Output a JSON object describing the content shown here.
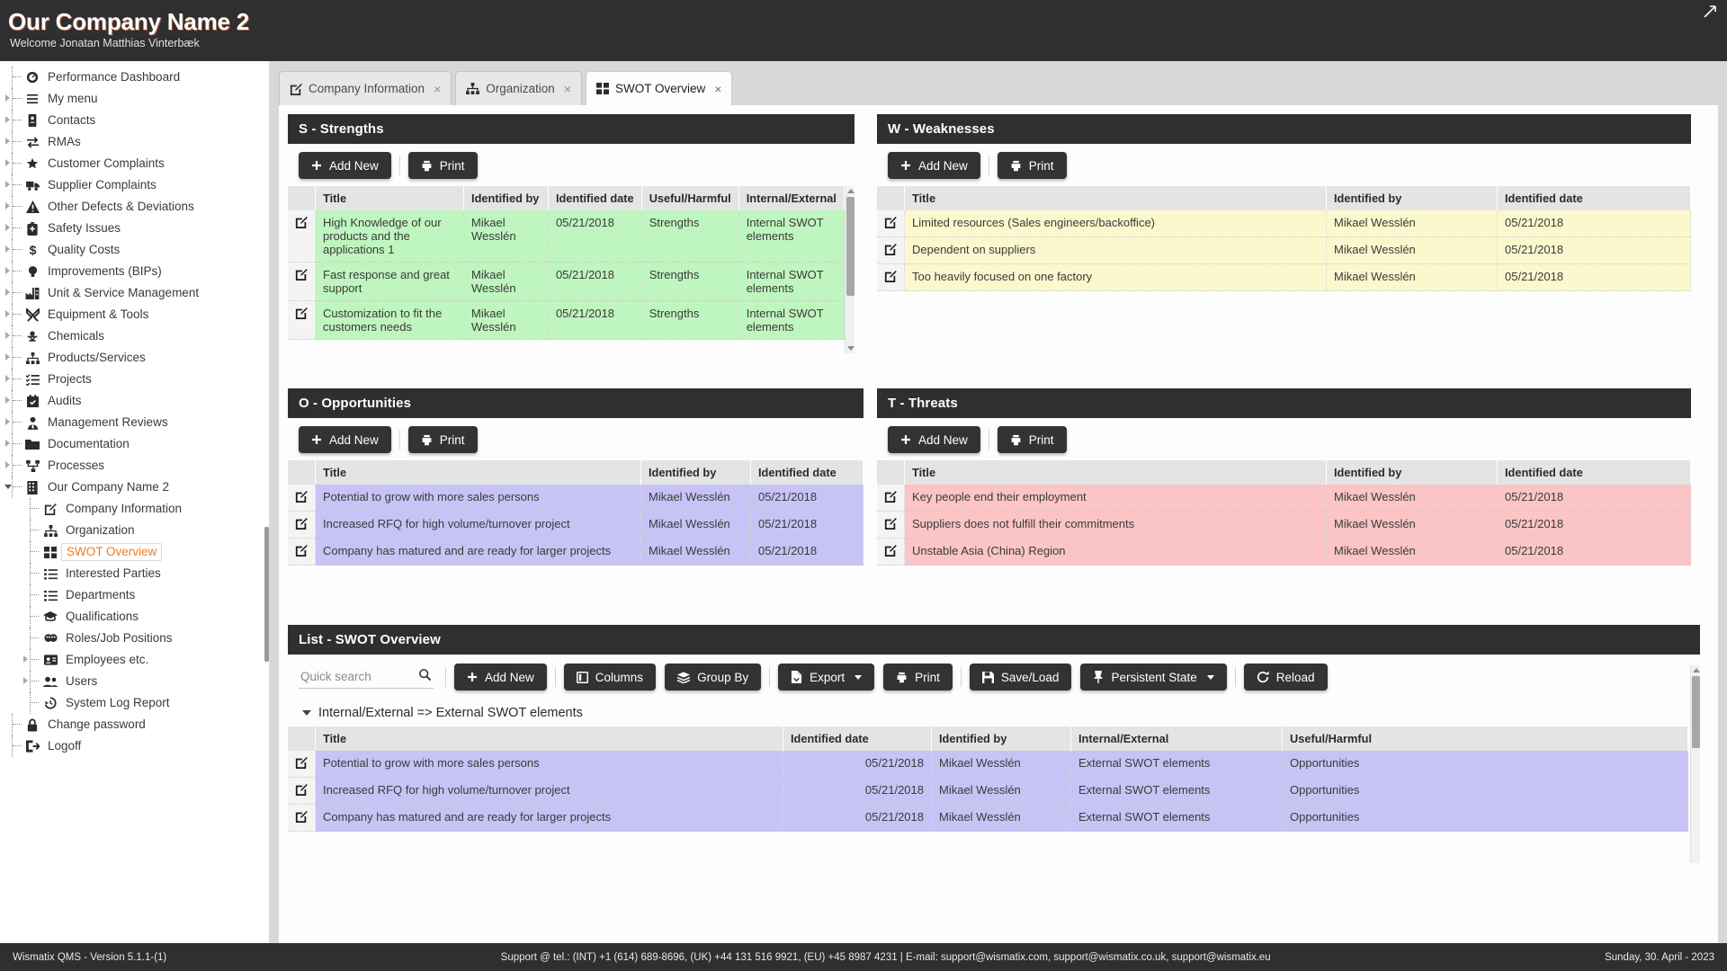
{
  "header": {
    "title": "Our Company Name 2",
    "welcome": "Welcome Jonatan Matthias Vinterbæk",
    "collapse_icon": "collapse-icon"
  },
  "sidebar": {
    "items": [
      {
        "label": "Performance Dashboard",
        "icon": "dashboard-icon",
        "level": 1,
        "arrow": "none",
        "active": false
      },
      {
        "label": "My menu",
        "icon": "menu-icon",
        "level": 1,
        "arrow": "collapsed",
        "active": false
      },
      {
        "label": "Contacts",
        "icon": "contacts-icon",
        "level": 1,
        "arrow": "collapsed",
        "active": false
      },
      {
        "label": "RMAs",
        "icon": "exchange-icon",
        "level": 1,
        "arrow": "collapsed",
        "active": false
      },
      {
        "label": "Customer Complaints",
        "icon": "star-icon",
        "level": 1,
        "arrow": "collapsed",
        "active": false
      },
      {
        "label": "Supplier Complaints",
        "icon": "truck-icon",
        "level": 1,
        "arrow": "collapsed",
        "active": false
      },
      {
        "label": "Other Defects & Deviations",
        "icon": "warning-icon",
        "level": 1,
        "arrow": "collapsed",
        "active": false
      },
      {
        "label": "Safety Issues",
        "icon": "safety-icon",
        "level": 1,
        "arrow": "collapsed",
        "active": false
      },
      {
        "label": "Quality Costs",
        "icon": "dollar-icon",
        "level": 1,
        "arrow": "collapsed",
        "active": false
      },
      {
        "label": "Improvements (BIPs)",
        "icon": "lightbulb-icon",
        "level": 1,
        "arrow": "collapsed",
        "active": false
      },
      {
        "label": "Unit & Service Management",
        "icon": "industry-icon",
        "level": 1,
        "arrow": "collapsed",
        "active": false
      },
      {
        "label": "Equipment & Tools",
        "icon": "tools-icon",
        "level": 1,
        "arrow": "collapsed",
        "active": false
      },
      {
        "label": "Chemicals",
        "icon": "biohazard-icon",
        "level": 1,
        "arrow": "collapsed",
        "active": false
      },
      {
        "label": "Products/Services",
        "icon": "sitemap-icon",
        "level": 1,
        "arrow": "collapsed",
        "active": false
      },
      {
        "label": "Projects",
        "icon": "tasks-icon",
        "level": 1,
        "arrow": "collapsed",
        "active": false
      },
      {
        "label": "Audits",
        "icon": "calendar-check-icon",
        "level": 1,
        "arrow": "collapsed",
        "active": false
      },
      {
        "label": "Management Reviews",
        "icon": "user-tie-icon",
        "level": 1,
        "arrow": "collapsed",
        "active": false
      },
      {
        "label": "Documentation",
        "icon": "folder-icon",
        "level": 1,
        "arrow": "collapsed",
        "active": false
      },
      {
        "label": "Processes",
        "icon": "process-icon",
        "level": 1,
        "arrow": "collapsed",
        "active": false
      },
      {
        "label": "Our Company Name 2",
        "icon": "building-icon",
        "level": 1,
        "arrow": "expanded",
        "active": false
      },
      {
        "label": "Company Information",
        "icon": "edit-icon",
        "level": 2,
        "arrow": "none",
        "active": false
      },
      {
        "label": "Organization",
        "icon": "org-icon",
        "level": 2,
        "arrow": "none",
        "active": false
      },
      {
        "label": "SWOT Overview",
        "icon": "grid-icon",
        "level": 2,
        "arrow": "none",
        "active": true
      },
      {
        "label": "Interested Parties",
        "icon": "list-icon",
        "level": 2,
        "arrow": "none",
        "active": false
      },
      {
        "label": "Departments",
        "icon": "list-icon",
        "level": 2,
        "arrow": "none",
        "active": false
      },
      {
        "label": "Qualifications",
        "icon": "graduation-icon",
        "level": 2,
        "arrow": "none",
        "active": false
      },
      {
        "label": "Roles/Job Positions",
        "icon": "masks-icon",
        "level": 2,
        "arrow": "none",
        "active": false
      },
      {
        "label": "Employees etc.",
        "icon": "idcard-icon",
        "level": 2,
        "arrow": "collapsed",
        "active": false
      },
      {
        "label": "Users",
        "icon": "users-icon",
        "level": 2,
        "arrow": "collapsed",
        "active": false
      },
      {
        "label": "System Log Report",
        "icon": "history-icon",
        "level": 2,
        "arrow": "none",
        "active": false
      },
      {
        "label": "Change password",
        "icon": "lock-icon",
        "level": 1,
        "arrow": "none",
        "active": false
      },
      {
        "label": "Logoff",
        "icon": "logout-icon",
        "level": 1,
        "arrow": "none",
        "active": false
      }
    ]
  },
  "tabs": [
    {
      "label": "Company Information",
      "icon": "edit-icon",
      "active": false,
      "close": "×"
    },
    {
      "label": "Organization",
      "icon": "org-icon",
      "active": false,
      "close": "×"
    },
    {
      "label": "SWOT Overview",
      "icon": "grid-icon",
      "active": true,
      "close": "×"
    }
  ],
  "buttons": {
    "add_new": "Add New",
    "print": "Print"
  },
  "panels": {
    "strengths": {
      "title": "S - Strengths",
      "columns": [
        "Title",
        "Identified by",
        "Identified date",
        "Useful/Harmful",
        "Internal/External"
      ],
      "rows": [
        {
          "title": "High Knowledge of our products and the applications 1",
          "identified_by": "Mikael Wesslén",
          "identified_date": "05/21/2018",
          "useful_harmful": "Strengths",
          "internal_external": "Internal SWOT elements"
        },
        {
          "title": "Fast response and great support",
          "identified_by": "Mikael Wesslén",
          "identified_date": "05/21/2018",
          "useful_harmful": "Strengths",
          "internal_external": "Internal SWOT elements"
        },
        {
          "title": "Customization to fit the customers needs",
          "identified_by": "Mikael Wesslén",
          "identified_date": "05/21/2018",
          "useful_harmful": "Strengths",
          "internal_external": "Internal SWOT elements"
        }
      ]
    },
    "weaknesses": {
      "title": "W - Weaknesses",
      "columns": [
        "Title",
        "Identified by",
        "Identified date"
      ],
      "rows": [
        {
          "title": "Limited resources (Sales engineers/backoffice)",
          "identified_by": "Mikael Wesslén",
          "identified_date": "05/21/2018"
        },
        {
          "title": "Dependent on suppliers",
          "identified_by": "Mikael Wesslén",
          "identified_date": "05/21/2018"
        },
        {
          "title": "Too heavily focused on one factory",
          "identified_by": "Mikael Wesslén",
          "identified_date": "05/21/2018"
        }
      ]
    },
    "opportunities": {
      "title": "O - Opportunities",
      "columns": [
        "Title",
        "Identified by",
        "Identified date"
      ],
      "rows": [
        {
          "title": "Potential to grow with more sales persons",
          "identified_by": "Mikael Wesslén",
          "identified_date": "05/21/2018"
        },
        {
          "title": "Increased RFQ for high volume/turnover project",
          "identified_by": "Mikael Wesslén",
          "identified_date": "05/21/2018"
        },
        {
          "title": "Company has matured and are ready for larger projects",
          "identified_by": "Mikael Wesslén",
          "identified_date": "05/21/2018"
        }
      ]
    },
    "threats": {
      "title": "T - Threats",
      "columns": [
        "Title",
        "Identified by",
        "Identified date"
      ],
      "rows": [
        {
          "title": "Key people end their employment",
          "identified_by": "Mikael Wesslén",
          "identified_date": "05/21/2018"
        },
        {
          "title": "Suppliers does not fulfill their commitments",
          "identified_by": "Mikael Wesslén",
          "identified_date": "05/21/2018"
        },
        {
          "title": "Unstable Asia (China) Region",
          "identified_by": "Mikael Wesslén",
          "identified_date": "05/21/2018"
        }
      ]
    }
  },
  "list": {
    "title": "List - SWOT Overview",
    "search_placeholder": "Quick search",
    "search_value": "",
    "toolbar": [
      {
        "label": "Add New",
        "icon": "plus-icon",
        "caret": false
      },
      {
        "label": "Columns",
        "icon": "columns-icon",
        "caret": false
      },
      {
        "label": "Group By",
        "icon": "layers-icon",
        "caret": false
      },
      {
        "label": "Export",
        "icon": "export-icon",
        "caret": true
      },
      {
        "label": "Print",
        "icon": "printer-icon",
        "caret": false
      },
      {
        "label": "Save/Load",
        "icon": "save-icon",
        "caret": false
      },
      {
        "label": "Persistent State",
        "icon": "pin-icon",
        "caret": true
      },
      {
        "label": "Reload",
        "icon": "reload-icon",
        "caret": false
      }
    ],
    "group_label": "Internal/External => External SWOT elements",
    "columns": [
      "Title",
      "Identified date",
      "Identified by",
      "Internal/External",
      "Useful/Harmful"
    ],
    "rows": [
      {
        "title": "Potential to grow with more sales persons",
        "identified_date": "05/21/2018",
        "identified_by": "Mikael Wesslén",
        "internal_external": "External SWOT elements",
        "useful_harmful": "Opportunities"
      },
      {
        "title": "Increased RFQ for high volume/turnover project",
        "identified_date": "05/21/2018",
        "identified_by": "Mikael Wesslén",
        "internal_external": "External SWOT elements",
        "useful_harmful": "Opportunities"
      },
      {
        "title": "Company has matured and are ready for larger projects",
        "identified_date": "05/21/2018",
        "identified_by": "Mikael Wesslén",
        "internal_external": "External SWOT elements",
        "useful_harmful": "Opportunities"
      }
    ]
  },
  "footer": {
    "left": "Wismatix QMS - Version 5.1.1-(1)",
    "center": "Support @ tel.: (INT) +1 (614) 689-8696, (UK) +44 131 516 9921, (EU) +45 8987 4231 | E-mail: support@wismatix.com, support@wismatix.co.uk, support@wismatix.eu",
    "right": "Sunday, 30. April - 2023"
  },
  "colors": {
    "header_bg": "#2f2f2f",
    "accent": "#f07c1e",
    "strengths": "#bff5bf",
    "weaknesses": "#fbf8cd",
    "opportunities": "#c7c3f5",
    "threats": "#fbc5c5"
  }
}
